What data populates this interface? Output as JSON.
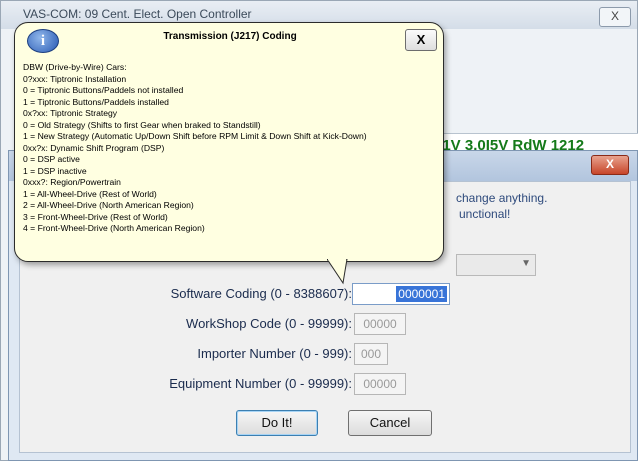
{
  "back_window": {
    "title": "VAS-COM: 09 Cent. Elect. Open Controller",
    "close_label": "X",
    "status_text": "01V 3.0I5V RdW 1212"
  },
  "dialog": {
    "close_label": "X",
    "warning_lines": [
      "change anything.",
      "unctional!"
    ],
    "fields": [
      {
        "label": "Software Coding (0 - 8388607):",
        "value": "0000001"
      },
      {
        "label": "WorkShop Code (0 - 99999):",
        "value": "00000"
      },
      {
        "label": "Importer Number (0 - 999):",
        "value": "000"
      },
      {
        "label": "Equipment Number (0 - 99999):",
        "value": "00000"
      }
    ],
    "ok_label": "Do It!",
    "cancel_label": "Cancel"
  },
  "balloon": {
    "title": "Transmission (J217) Coding",
    "close_label": "X",
    "info_icon": "info-icon",
    "lines": [
      "DBW (Drive-by-Wire) Cars:",
      "0?xxx: Tiptronic Installation",
      "0 = Tiptronic Buttons/Paddels not installed",
      "1 = Tiptronic Buttons/Paddels installed",
      "0x?xx: Tiptronic Strategy",
      "0 = Old Strategy (Shifts to first Gear when braked to Standstill)",
      "1 = New Strategy (Automatic Up/Down Shift before RPM Limit & Down Shift at Kick-Down)",
      "0xx?x: Dynamic Shift Program (DSP)",
      "0 = DSP active",
      "1 = DSP inactive",
      "0xxx?: Region/Powertrain",
      "1 = All-Wheel-Drive (Rest of World)",
      "2 = All-Wheel-Drive (North American Region)",
      "3 = Front-Wheel-Drive (Rest of World)",
      "4 = Front-Wheel-Drive (North American Region)"
    ]
  },
  "colors": {
    "balloon_bg": "#ffffe1",
    "status_text": "#157a1a",
    "selection": "#3874d8"
  }
}
